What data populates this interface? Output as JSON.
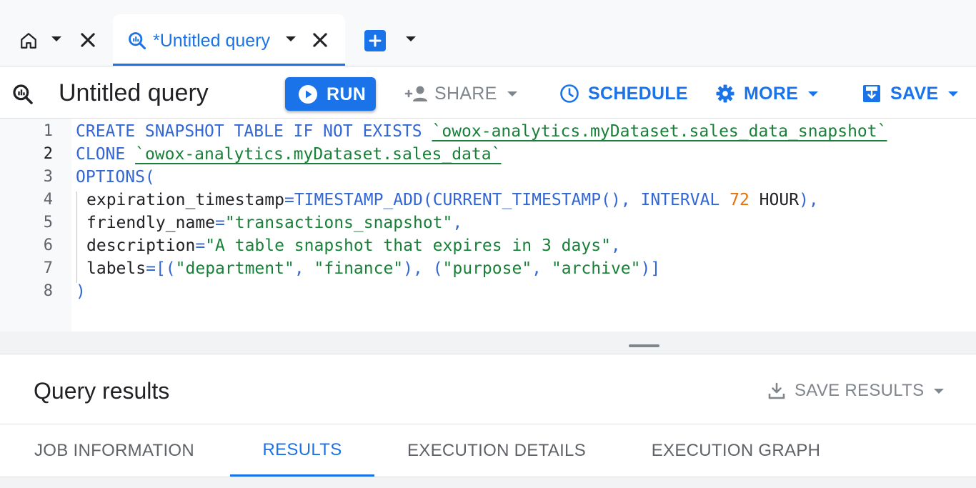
{
  "tabs": {
    "home_icon": "home-icon",
    "query_tab_title": "*Untitled query",
    "query_tab_icon": "query-icon",
    "new_tab_icon": "plus-icon"
  },
  "toolbar": {
    "title": "Untitled query",
    "run_label": "RUN",
    "share_label": "SHARE",
    "schedule_label": "SCHEDULE",
    "more_label": "MORE",
    "save_label": "SAVE"
  },
  "editor": {
    "line_numbers": [
      "1",
      "2",
      "3",
      "4",
      "5",
      "6",
      "7",
      "8"
    ],
    "active_line": 2,
    "lines": {
      "l1": {
        "kw": "CREATE SNAPSHOT TABLE IF NOT EXISTS ",
        "table": "`owox-analytics.myDataset.sales_data_snapshot`"
      },
      "l2": {
        "kw": "CLONE ",
        "table": "`owox-analytics.myDataset.sales_data`"
      },
      "l3": {
        "kw": "OPTIONS("
      },
      "l4": {
        "key": "expiration_timestamp",
        "eq": "=",
        "fn1": "TIMESTAMP_ADD(",
        "fn2": "CURRENT_TIMESTAMP",
        "paren": "()",
        "comma": ", ",
        "kw": "INTERVAL ",
        "num": "72",
        "unit": " HOUR",
        "close": "),"
      },
      "l5": {
        "key": "friendly_name",
        "eq": "=",
        "val": "\"transactions_snapshot\"",
        "comma": ","
      },
      "l6": {
        "key": "description",
        "eq": "=",
        "val": "\"A table snapshot that expires in 3 days\"",
        "comma": ","
      },
      "l7": {
        "key": "labels",
        "eq": "=",
        "open": "[(",
        "s1": "\"department\"",
        "c1": ", ",
        "s2": "\"finance\"",
        "mid": "), (",
        "s3": "\"purpose\"",
        "c2": ", ",
        "s4": "\"archive\"",
        "close": ")]"
      },
      "l8": {
        "kw": ")"
      }
    }
  },
  "results": {
    "title": "Query results",
    "save_results_label": "SAVE RESULTS",
    "tabs": [
      "JOB INFORMATION",
      "RESULTS",
      "EXECUTION DETAILS",
      "EXECUTION GRAPH"
    ],
    "active_tab": "RESULTS"
  },
  "colors": {
    "accent": "#1a73e8",
    "keyword": "#3367d6",
    "string": "#188038",
    "number": "#e8710a"
  }
}
